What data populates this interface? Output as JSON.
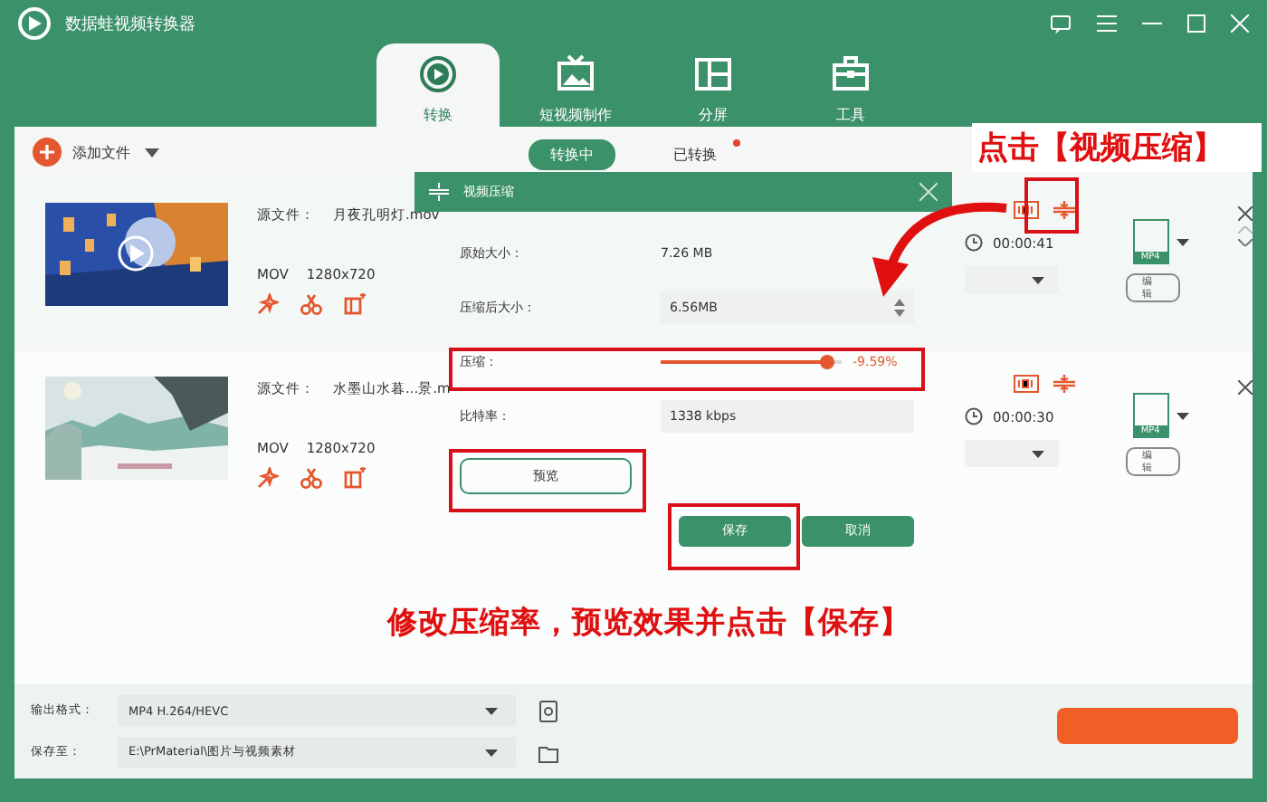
{
  "window": {
    "title": "数据蛙视频转换器"
  },
  "tabs": [
    {
      "label": "转换",
      "selected": true
    },
    {
      "label": "短视频制作",
      "selected": false
    },
    {
      "label": "分屏",
      "selected": false
    },
    {
      "label": "工具",
      "selected": false
    }
  ],
  "toolbar": {
    "add_file": "添加文件",
    "segments": [
      {
        "label": "转换中",
        "selected": true,
        "badge": false
      },
      {
        "label": "已转换",
        "selected": false,
        "badge": true
      }
    ]
  },
  "files": [
    {
      "source_label": "源文件：",
      "name": "月夜孔明灯.mov",
      "format": "MOV",
      "resolution": "1280x720",
      "duration": "00:00:41",
      "output_format": "MP4",
      "edit": "编辑"
    },
    {
      "source_label": "源文件：",
      "name": "水墨山水暮...景.m",
      "format": "MOV",
      "resolution": "1280x720",
      "duration": "00:00:30",
      "output_format": "MP4",
      "edit": "编辑"
    }
  ],
  "bottom_bar": {
    "output_label": "输出格式：",
    "output_value": "MP4 H.264/HEVC",
    "save_label": "保存至：",
    "save_value": "E:\\PrMaterial\\图片与视频素材"
  },
  "dialog": {
    "title": "视频压缩",
    "original_label": "原始大小：",
    "original_value": "7.26 MB",
    "compressed_label": "压缩后大小：",
    "compressed_value": "6.56MB",
    "compression_label": "压缩：",
    "compression": {
      "level": 0.92,
      "reading": "-9.59%"
    },
    "bitrate_label": "比特率：",
    "bitrate_value": "1338 kbps",
    "preview": "预览",
    "save": "保存",
    "cancel": "取消"
  },
  "annotations": {
    "callout_top": "点击【视频压缩】",
    "callout_bottom": "修改压缩率，预览效果并点击【保存】"
  }
}
